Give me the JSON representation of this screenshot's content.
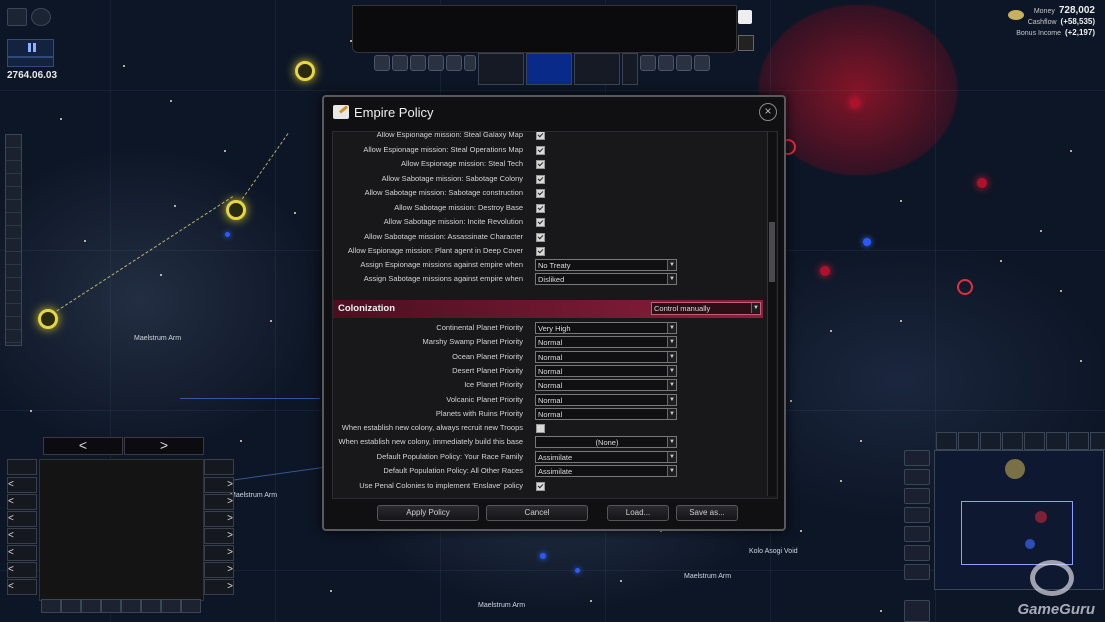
{
  "hud": {
    "date": "2764.06.03",
    "money_label": "Money",
    "money_value": "728,002",
    "cashflow_label": "Cashflow",
    "cashflow_value": "(+58,535)",
    "bonus_label": "Bonus Income",
    "bonus_value": "(+2,197)"
  },
  "map_labels": {
    "maelstrum_1": "Maelstrum Arm",
    "maelstrum_2": "Maelstrum Arm",
    "maelstrum_3": "Maelstrum Arm",
    "maelstrum_4": "Maelstrum Arm",
    "kolo_void": "Kolo Asogi Void"
  },
  "bottom_left": {
    "prev_label": "<",
    "next_label": ">"
  },
  "dialog": {
    "title": "Empire Policy",
    "close_label": "×",
    "rows": [
      {
        "label": "Allow Espionage mission: Steal Galaxy Map",
        "checked": true
      },
      {
        "label": "Allow Espionage mission: Steal Operations Map",
        "checked": true
      },
      {
        "label": "Allow Espionage mission: Steal Tech",
        "checked": true
      },
      {
        "label": "Allow Sabotage mission: Sabotage Colony",
        "checked": true
      },
      {
        "label": "Allow Sabotage mission: Sabotage construction",
        "checked": true
      },
      {
        "label": "Allow Sabotage mission: Destroy Base",
        "checked": true
      },
      {
        "label": "Allow Sabotage mission: Incite Revolution",
        "checked": true
      },
      {
        "label": "Allow Sabotage mission: Assassinate Character",
        "checked": true
      },
      {
        "label": "Allow Espionage mission: Plant agent in Deep Cover",
        "checked": true
      }
    ],
    "espionage_against_label": "Assign Espionage missions against empire when",
    "espionage_against_value": "No Treaty",
    "sabotage_against_label": "Assign Sabotage missions against empire when",
    "sabotage_against_value": "Disliked",
    "colonization": {
      "title": "Colonization",
      "mode": "Control manually",
      "priorities": [
        {
          "label": "Continental Planet Priority",
          "value": "Very High"
        },
        {
          "label": "Marshy Swamp Planet Priority",
          "value": "Normal"
        },
        {
          "label": "Ocean Planet Priority",
          "value": "Normal"
        },
        {
          "label": "Desert Planet Priority",
          "value": "Normal"
        },
        {
          "label": "Ice Planet Priority",
          "value": "Normal"
        },
        {
          "label": "Volcanic Planet Priority",
          "value": "Normal"
        },
        {
          "label": "Planets with Ruins Priority",
          "value": "Normal"
        }
      ],
      "recruit_troops_label": "When establish new colony, always recruit new Troops",
      "recruit_troops_checked": false,
      "build_base_label": "When establish new colony, immediately build this base",
      "build_base_value": "(None)",
      "pop_race_label": "Default Population Policy: Your Race Family",
      "pop_race_value": "Assimilate",
      "pop_other_label": "Default Population Policy: All Other Races",
      "pop_other_value": "Assimilate",
      "penal_label": "Use Penal Colonies to implement 'Enslave' policy",
      "penal_checked": true
    },
    "buttons": {
      "apply": "Apply Policy",
      "cancel": "Cancel",
      "load": "Load...",
      "save": "Save as..."
    }
  },
  "watermark": "GameGuru",
  "colors": {
    "section_bar": "#7a1a34",
    "system_yellow": "#e7d640",
    "system_red": "#b0102a",
    "system_blue": "#2a5aff"
  }
}
